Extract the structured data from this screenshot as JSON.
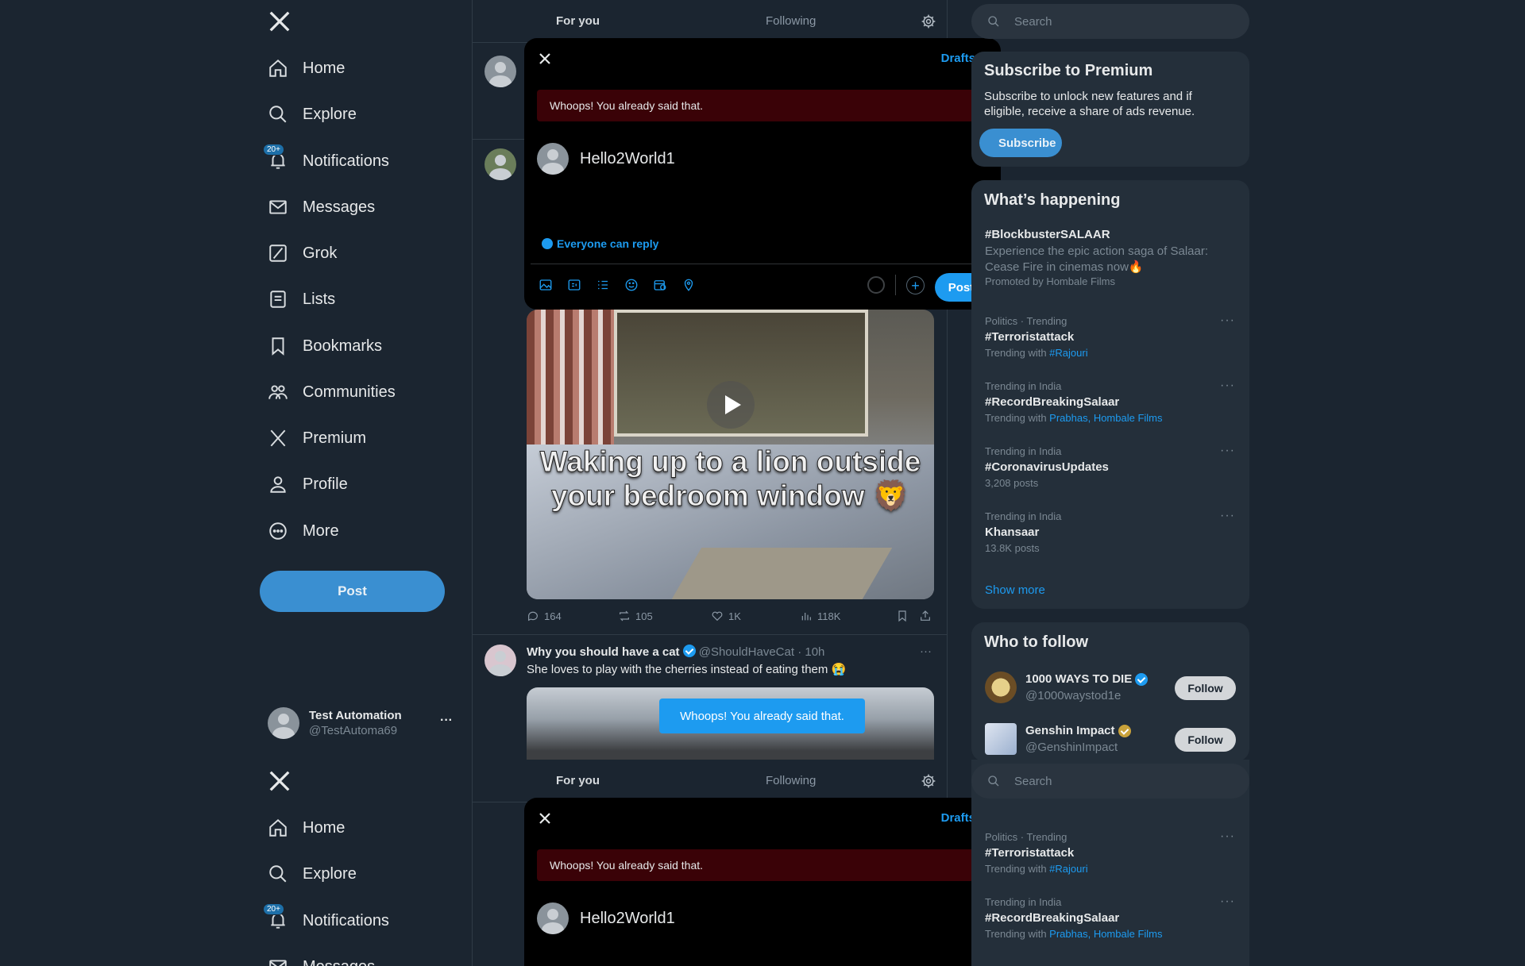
{
  "colors": {
    "accent": "#1d9bf0",
    "background": "#1b2530",
    "panel": "#242f3a",
    "error": "#3a0207",
    "gold": "#c9a23a"
  },
  "nav": {
    "items": [
      {
        "label": "Home",
        "icon": "home-icon"
      },
      {
        "label": "Explore",
        "icon": "search-icon"
      },
      {
        "label": "Notifications",
        "icon": "bell-icon",
        "badge": "20+"
      },
      {
        "label": "Messages",
        "icon": "mail-icon"
      },
      {
        "label": "Grok",
        "icon": "grok-icon"
      },
      {
        "label": "Lists",
        "icon": "list-icon"
      },
      {
        "label": "Bookmarks",
        "icon": "bookmark-icon"
      },
      {
        "label": "Communities",
        "icon": "communities-icon"
      },
      {
        "label": "Premium",
        "icon": "x-logo-icon"
      },
      {
        "label": "Profile",
        "icon": "person-icon"
      },
      {
        "label": "More",
        "icon": "more-circle-icon"
      }
    ],
    "post_label": "Post"
  },
  "account": {
    "name": "Test Automation",
    "handle": "@TestAutoma69",
    "menu": "···"
  },
  "feed": {
    "tabs": {
      "for_you": "For you",
      "following": "Following"
    },
    "video_caption": "Waking up to a lion outside your bedroom window 🦁",
    "tweet1_stats": {
      "replies": "164",
      "reposts": "105",
      "likes": "1K",
      "views": "118K"
    },
    "tweet2": {
      "name": "Why you should have a cat",
      "handle": "@ShouldHaveCat",
      "time": "· 10h",
      "text": "She loves to play with the cherries instead of eating them 😭",
      "menu": "···"
    }
  },
  "toast": "Whoops! You already said that.",
  "compose": {
    "drafts": "Drafts",
    "error": "Whoops! You already said that.",
    "text": "Hello2World1",
    "reply_setting": "Everyone can reply",
    "post": "Post",
    "plus": "+"
  },
  "right": {
    "search_placeholder": "Search",
    "premium": {
      "title": "Subscribe to Premium",
      "line1": "Subscribe to unlock new features and if",
      "line2": "eligible, receive a share of ads revenue.",
      "button": "Subscribe"
    },
    "happening": {
      "title": "What’s happening",
      "promo": {
        "name": "#BlockbusterSALAAR",
        "line1": "Experience the epic action saga of Salaar:",
        "line2": "Cease Fire in cinemas now🔥",
        "promoted": "Promoted by Hombale Films"
      },
      "trends": [
        {
          "category": "Politics · Trending",
          "name": "#Terroristattack",
          "sub_prefix": "Trending with ",
          "sub_link": "#Rajouri",
          "menu": "···"
        },
        {
          "category": "Trending in India",
          "name": "#RecordBreakingSalaar",
          "sub_prefix": "Trending with ",
          "sub_link": "Prabhas, Hombale Films",
          "menu": "···"
        },
        {
          "category": "Trending in India",
          "name": "#CoronavirusUpdates",
          "sub_prefix": "3,208 posts",
          "sub_link": "",
          "menu": "···"
        },
        {
          "category": "Trending in India",
          "name": "Khansaar",
          "sub_prefix": "13.8K posts",
          "sub_link": "",
          "menu": "···"
        }
      ],
      "show_more": "Show more"
    },
    "who_to_follow": {
      "title": "Who to follow",
      "accounts": [
        {
          "name": "1000 WAYS TO DIE",
          "handle": "@1000waystod1e",
          "button": "Follow",
          "badge_color": "#1d9bf0"
        },
        {
          "name": "Genshin Impact",
          "handle": "@GenshinImpact",
          "button": "Follow",
          "badge_color": "#c9a23a"
        }
      ]
    }
  }
}
